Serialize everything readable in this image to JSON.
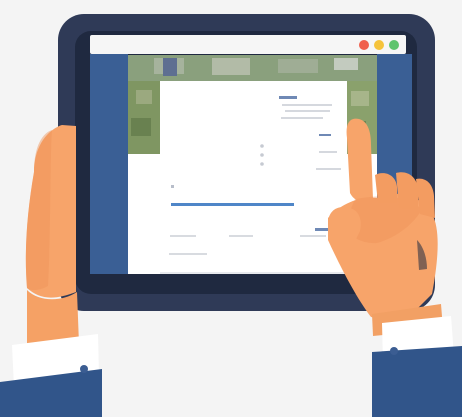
{
  "colors": {
    "background": "#f4f4f4",
    "tablet_body": "#2f3a57",
    "tablet_bezel": "#1f2940",
    "browser_bar": "#f5f5f5",
    "screen_panel": "#2f4f81",
    "page_white": "#ffffff",
    "skin": "#f7a46a",
    "skin_shadow": "#e98a55",
    "sleeve": "#31558a",
    "cuff": "#ffffff",
    "progress_blue": "#4f86c8",
    "dot_red": "#f0604d",
    "dot_yellow": "#f5c33b",
    "dot_green": "#5ec46d",
    "map_green": "#6e8f59"
  },
  "icons": {
    "window_controls": [
      "red-dot-icon",
      "yellow-dot-icon",
      "green-dot-icon"
    ]
  }
}
